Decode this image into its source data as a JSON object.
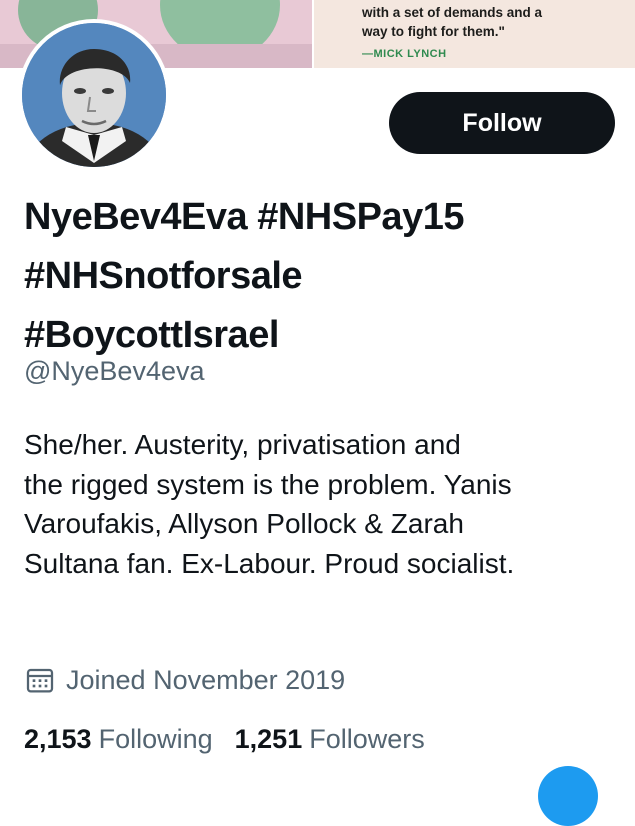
{
  "banner": {
    "quote_line1": "with a set of demands and a",
    "quote_line2": "way to fight for them.\"",
    "quote_author": "—MICK LYNCH"
  },
  "avatar": {
    "icon": "profile-photo"
  },
  "follow_button": {
    "label": "Follow"
  },
  "profile": {
    "name_lines": [
      "NyeBev4Eva #NHSPay15",
      "#NHSnotforsale",
      "#BoycottIsrael"
    ],
    "handle": "@NyeBev4eva",
    "bio_lines": [
      "She/her. Austerity, privatisation and",
      "the rigged system is the problem. Yanis",
      "Varoufakis, Allyson Pollock & Zarah",
      "Sultana fan. Ex-Labour. Proud socialist."
    ],
    "joined": {
      "icon": "calendar-icon",
      "text": "Joined November 2019"
    },
    "stats": {
      "following_count": "2,153",
      "following_label": "Following",
      "followers_count": "1,251",
      "followers_label": "Followers"
    }
  },
  "colors": {
    "text": "#0f1419",
    "secondary": "#536471",
    "button_bg": "#0f1419",
    "accent_blue": "#1d9bf0"
  }
}
